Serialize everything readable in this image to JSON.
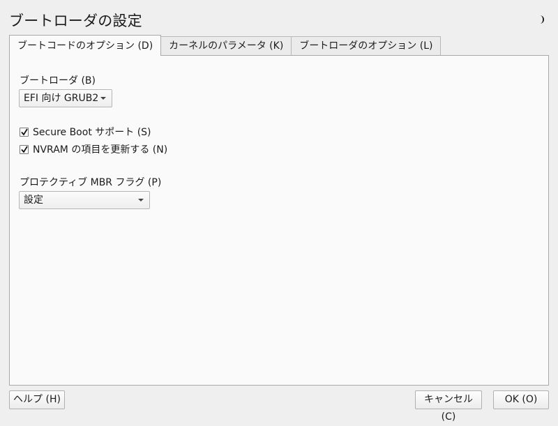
{
  "window": {
    "title": "ブートローダの設定",
    "theme_icon": "moon-icon"
  },
  "tabs": [
    {
      "label": "ブートコードのオプション (D)",
      "active": true
    },
    {
      "label": "カーネルのパラメータ (K)",
      "active": false
    },
    {
      "label": "ブートローダのオプション (L)",
      "active": false
    }
  ],
  "bootloader": {
    "label": "ブートローダ (B)",
    "value": "EFI 向け GRUB2"
  },
  "options": {
    "secure_boot": {
      "label": "Secure Boot サポート (S)",
      "checked": true
    },
    "nvram": {
      "label": "NVRAM の項目を更新する (N)",
      "checked": true
    }
  },
  "protective_mbr": {
    "label": "プロテクティブ MBR フラグ (P)",
    "value": "設定"
  },
  "buttons": {
    "help": "ヘルプ (H)",
    "cancel": "キャンセル (C)",
    "ok": "OK (O)"
  }
}
